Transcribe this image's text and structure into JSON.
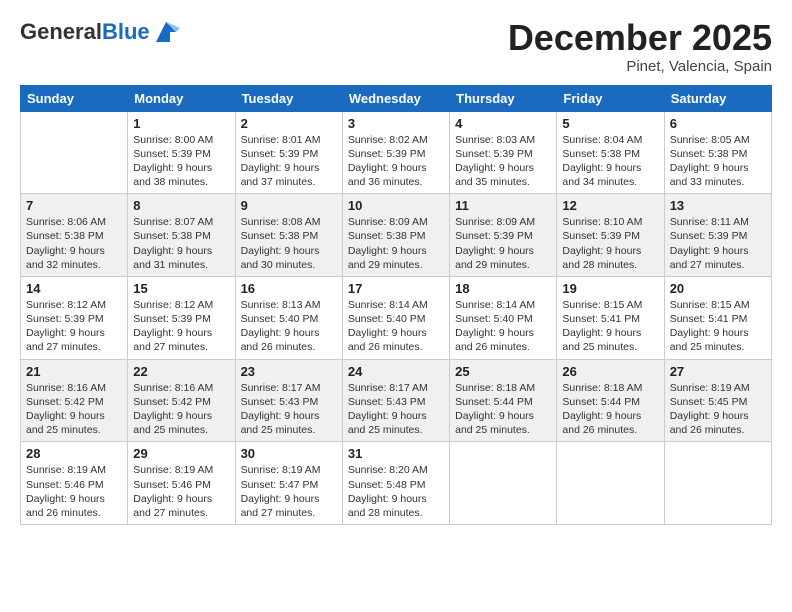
{
  "logo": {
    "general": "General",
    "blue": "Blue"
  },
  "header": {
    "month": "December 2025",
    "location": "Pinet, Valencia, Spain"
  },
  "weekdays": [
    "Sunday",
    "Monday",
    "Tuesday",
    "Wednesday",
    "Thursday",
    "Friday",
    "Saturday"
  ],
  "weeks": [
    [
      {
        "day": "",
        "info": ""
      },
      {
        "day": "1",
        "info": "Sunrise: 8:00 AM\nSunset: 5:39 PM\nDaylight: 9 hours\nand 38 minutes."
      },
      {
        "day": "2",
        "info": "Sunrise: 8:01 AM\nSunset: 5:39 PM\nDaylight: 9 hours\nand 37 minutes."
      },
      {
        "day": "3",
        "info": "Sunrise: 8:02 AM\nSunset: 5:39 PM\nDaylight: 9 hours\nand 36 minutes."
      },
      {
        "day": "4",
        "info": "Sunrise: 8:03 AM\nSunset: 5:39 PM\nDaylight: 9 hours\nand 35 minutes."
      },
      {
        "day": "5",
        "info": "Sunrise: 8:04 AM\nSunset: 5:38 PM\nDaylight: 9 hours\nand 34 minutes."
      },
      {
        "day": "6",
        "info": "Sunrise: 8:05 AM\nSunset: 5:38 PM\nDaylight: 9 hours\nand 33 minutes."
      }
    ],
    [
      {
        "day": "7",
        "info": "Sunrise: 8:06 AM\nSunset: 5:38 PM\nDaylight: 9 hours\nand 32 minutes."
      },
      {
        "day": "8",
        "info": "Sunrise: 8:07 AM\nSunset: 5:38 PM\nDaylight: 9 hours\nand 31 minutes."
      },
      {
        "day": "9",
        "info": "Sunrise: 8:08 AM\nSunset: 5:38 PM\nDaylight: 9 hours\nand 30 minutes."
      },
      {
        "day": "10",
        "info": "Sunrise: 8:09 AM\nSunset: 5:38 PM\nDaylight: 9 hours\nand 29 minutes."
      },
      {
        "day": "11",
        "info": "Sunrise: 8:09 AM\nSunset: 5:39 PM\nDaylight: 9 hours\nand 29 minutes."
      },
      {
        "day": "12",
        "info": "Sunrise: 8:10 AM\nSunset: 5:39 PM\nDaylight: 9 hours\nand 28 minutes."
      },
      {
        "day": "13",
        "info": "Sunrise: 8:11 AM\nSunset: 5:39 PM\nDaylight: 9 hours\nand 27 minutes."
      }
    ],
    [
      {
        "day": "14",
        "info": "Sunrise: 8:12 AM\nSunset: 5:39 PM\nDaylight: 9 hours\nand 27 minutes."
      },
      {
        "day": "15",
        "info": "Sunrise: 8:12 AM\nSunset: 5:39 PM\nDaylight: 9 hours\nand 27 minutes."
      },
      {
        "day": "16",
        "info": "Sunrise: 8:13 AM\nSunset: 5:40 PM\nDaylight: 9 hours\nand 26 minutes."
      },
      {
        "day": "17",
        "info": "Sunrise: 8:14 AM\nSunset: 5:40 PM\nDaylight: 9 hours\nand 26 minutes."
      },
      {
        "day": "18",
        "info": "Sunrise: 8:14 AM\nSunset: 5:40 PM\nDaylight: 9 hours\nand 26 minutes."
      },
      {
        "day": "19",
        "info": "Sunrise: 8:15 AM\nSunset: 5:41 PM\nDaylight: 9 hours\nand 25 minutes."
      },
      {
        "day": "20",
        "info": "Sunrise: 8:15 AM\nSunset: 5:41 PM\nDaylight: 9 hours\nand 25 minutes."
      }
    ],
    [
      {
        "day": "21",
        "info": "Sunrise: 8:16 AM\nSunset: 5:42 PM\nDaylight: 9 hours\nand 25 minutes."
      },
      {
        "day": "22",
        "info": "Sunrise: 8:16 AM\nSunset: 5:42 PM\nDaylight: 9 hours\nand 25 minutes."
      },
      {
        "day": "23",
        "info": "Sunrise: 8:17 AM\nSunset: 5:43 PM\nDaylight: 9 hours\nand 25 minutes."
      },
      {
        "day": "24",
        "info": "Sunrise: 8:17 AM\nSunset: 5:43 PM\nDaylight: 9 hours\nand 25 minutes."
      },
      {
        "day": "25",
        "info": "Sunrise: 8:18 AM\nSunset: 5:44 PM\nDaylight: 9 hours\nand 25 minutes."
      },
      {
        "day": "26",
        "info": "Sunrise: 8:18 AM\nSunset: 5:44 PM\nDaylight: 9 hours\nand 26 minutes."
      },
      {
        "day": "27",
        "info": "Sunrise: 8:19 AM\nSunset: 5:45 PM\nDaylight: 9 hours\nand 26 minutes."
      }
    ],
    [
      {
        "day": "28",
        "info": "Sunrise: 8:19 AM\nSunset: 5:46 PM\nDaylight: 9 hours\nand 26 minutes."
      },
      {
        "day": "29",
        "info": "Sunrise: 8:19 AM\nSunset: 5:46 PM\nDaylight: 9 hours\nand 27 minutes."
      },
      {
        "day": "30",
        "info": "Sunrise: 8:19 AM\nSunset: 5:47 PM\nDaylight: 9 hours\nand 27 minutes."
      },
      {
        "day": "31",
        "info": "Sunrise: 8:20 AM\nSunset: 5:48 PM\nDaylight: 9 hours\nand 28 minutes."
      },
      {
        "day": "",
        "info": ""
      },
      {
        "day": "",
        "info": ""
      },
      {
        "day": "",
        "info": ""
      }
    ]
  ]
}
